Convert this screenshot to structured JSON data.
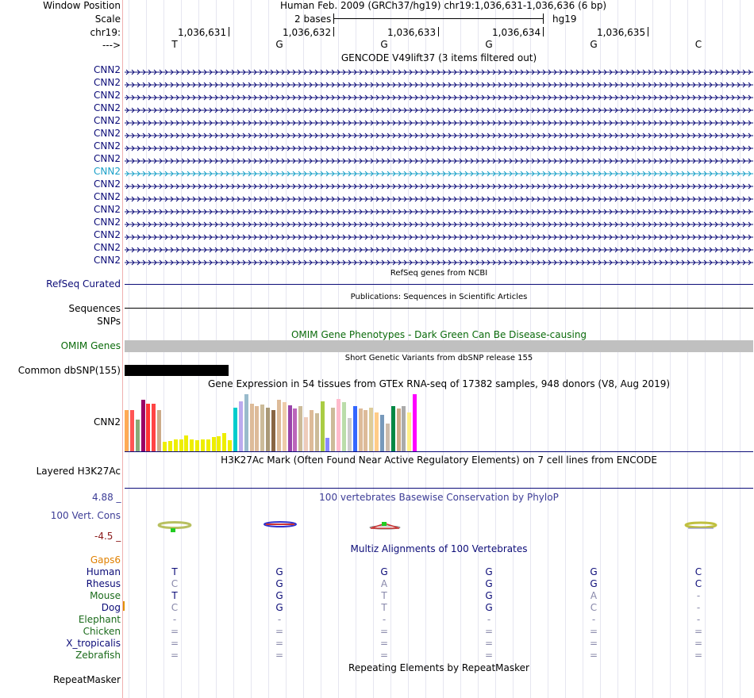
{
  "header": {
    "window_position_label": "Window Position",
    "position_text": "Human Feb. 2009 (GRCh37/hg19)   chr19:1,036,631-1,036,636 (6 bp)",
    "scale_label": "Scale",
    "scale_text": "2 bases",
    "assembly": "hg19",
    "chrom_label": "chr19:",
    "strand_label": "--->"
  },
  "ruler": {
    "coords": [
      "1,036,631",
      "1,036,632",
      "1,036,633",
      "1,036,634",
      "1,036,635"
    ],
    "bases": [
      "T",
      "G",
      "G",
      "G",
      "G",
      "C"
    ]
  },
  "gencode": {
    "title": "GENCODE V49lift37 (3 items filtered out)",
    "transcripts": [
      "CNN2",
      "CNN2",
      "CNN2",
      "CNN2",
      "CNN2",
      "CNN2",
      "CNN2",
      "CNN2",
      "CNN2",
      "CNN2",
      "CNN2",
      "CNN2",
      "CNN2",
      "CNN2",
      "CNN2",
      "CNN2"
    ],
    "highlight_index": 8,
    "color": "#0c0c78",
    "highlight_color": "#1aa0c8"
  },
  "refseq": {
    "title": "RefSeq genes from NCBI",
    "label": "RefSeq Curated"
  },
  "publications": {
    "title": "Publications: Sequences in Scientific Articles",
    "label": "Sequences"
  },
  "snps_label": "SNPs",
  "omim": {
    "title": "OMIM Gene Phenotypes - Dark Green Can Be Disease-causing",
    "label": "OMIM Genes",
    "color": "#0b6b0b"
  },
  "dbsnp": {
    "title": "Short Genetic Variants from dbSNP release 155",
    "label": "Common dbSNP(155)"
  },
  "gtex": {
    "title": "Gene Expression in 54 tissues from GTEx RNA-seq of 17382 samples, 948 donors (V8, Aug 2019)",
    "label": "CNN2",
    "tissue_levels": [
      0.68,
      0.68,
      0.52,
      0.84,
      0.78,
      0.78,
      0.68,
      0.16,
      0.17,
      0.19,
      0.2,
      0.26,
      0.2,
      0.18,
      0.2,
      0.2,
      0.23,
      0.25,
      0.3,
      0.18,
      0.72,
      0.82,
      0.94,
      0.78,
      0.74,
      0.76,
      0.72,
      0.68,
      0.84,
      0.8,
      0.75,
      0.7,
      0.74,
      0.56,
      0.68,
      0.62,
      0.82,
      0.22,
      0.72,
      0.86,
      0.8,
      0.55,
      0.74,
      0.7,
      0.68,
      0.72,
      0.64,
      0.6,
      0.46,
      0.74,
      0.7,
      0.74,
      0.64,
      0.94
    ],
    "tissue_colors": [
      "#ffaa55",
      "#ff5555",
      "#88aa77",
      "#990066",
      "#ff3333",
      "#ff4444",
      "#ccaa88",
      "#eeee00",
      "#eeee00",
      "#eeee00",
      "#eeee00",
      "#eeee00",
      "#eeee00",
      "#eeee00",
      "#eeee00",
      "#eeee00",
      "#eeee00",
      "#eeee00",
      "#eeee00",
      "#eeee00",
      "#00cccc",
      "#bbaaee",
      "#99bbcc",
      "#ddbb99",
      "#ddbb99",
      "#ccbb99",
      "#aa9977",
      "#886644",
      "#ddbb99",
      "#eeccaa",
      "#9944aa",
      "#bb66bb",
      "#ccbb99",
      "#eeccbb",
      "#ddbb99",
      "#ccbb99",
      "#aacc44",
      "#8888ff",
      "#ccbb99",
      "#ffbbcc",
      "#bbddaa",
      "#cccccc",
      "#3366ff",
      "#ddbb99",
      "#ddbb99",
      "#ddcc99",
      "#ffcc88",
      "#7799bb",
      "#ccbbaa",
      "#008844",
      "#ccaa88",
      "#aaaaaa",
      "#ffee88",
      "#ff00ff"
    ]
  },
  "h3k27ac": {
    "title": "H3K27Ac Mark (Often Found Near Active Regulatory Elements) on 7 cell lines from ENCODE",
    "label": "Layered H3K27Ac"
  },
  "phylop": {
    "title": "100 vertebrates Basewise Conservation by PhyloP",
    "label": "100 Vert. Cons",
    "max_label": "4.88 _",
    "min_label": "-4.5 _",
    "color": "#3c3c96"
  },
  "multiz": {
    "title": "Multiz Alignments of 100 Vertebrates",
    "gaps_label": "Gaps6",
    "species": [
      {
        "name": "Human",
        "bases": [
          "T",
          "G",
          "G",
          "G",
          "G",
          "C"
        ],
        "color": "#0c0c78"
      },
      {
        "name": "Rhesus",
        "bases": [
          "C",
          "G",
          "A",
          "G",
          "G",
          "C"
        ],
        "color": "#0c0c78"
      },
      {
        "name": "Mouse",
        "bases": [
          "T",
          "G",
          "T",
          "G",
          "A",
          "-"
        ],
        "color": "#1b6b1b"
      },
      {
        "name": "Dog",
        "bases": [
          "C",
          "G",
          "T",
          "G",
          "C",
          "-"
        ],
        "color": "#0c0c78"
      },
      {
        "name": "Elephant",
        "bases": [
          "-",
          "-",
          "-",
          "-",
          "-",
          "-"
        ],
        "color": "#1b6b1b"
      },
      {
        "name": "Chicken",
        "bases": [
          "=",
          "=",
          "=",
          "=",
          "=",
          "="
        ],
        "color": "#1b6b1b"
      },
      {
        "name": "X_tropicalis",
        "bases": [
          "=",
          "=",
          "=",
          "=",
          "=",
          "="
        ],
        "color": "#0c0c78"
      },
      {
        "name": "Zebrafish",
        "bases": [
          "=",
          "=",
          "=",
          "=",
          "=",
          "="
        ],
        "color": "#1b6b1b"
      }
    ]
  },
  "repeatmasker": {
    "title": "Repeating Elements by RepeatMasker",
    "label": "RepeatMasker"
  }
}
